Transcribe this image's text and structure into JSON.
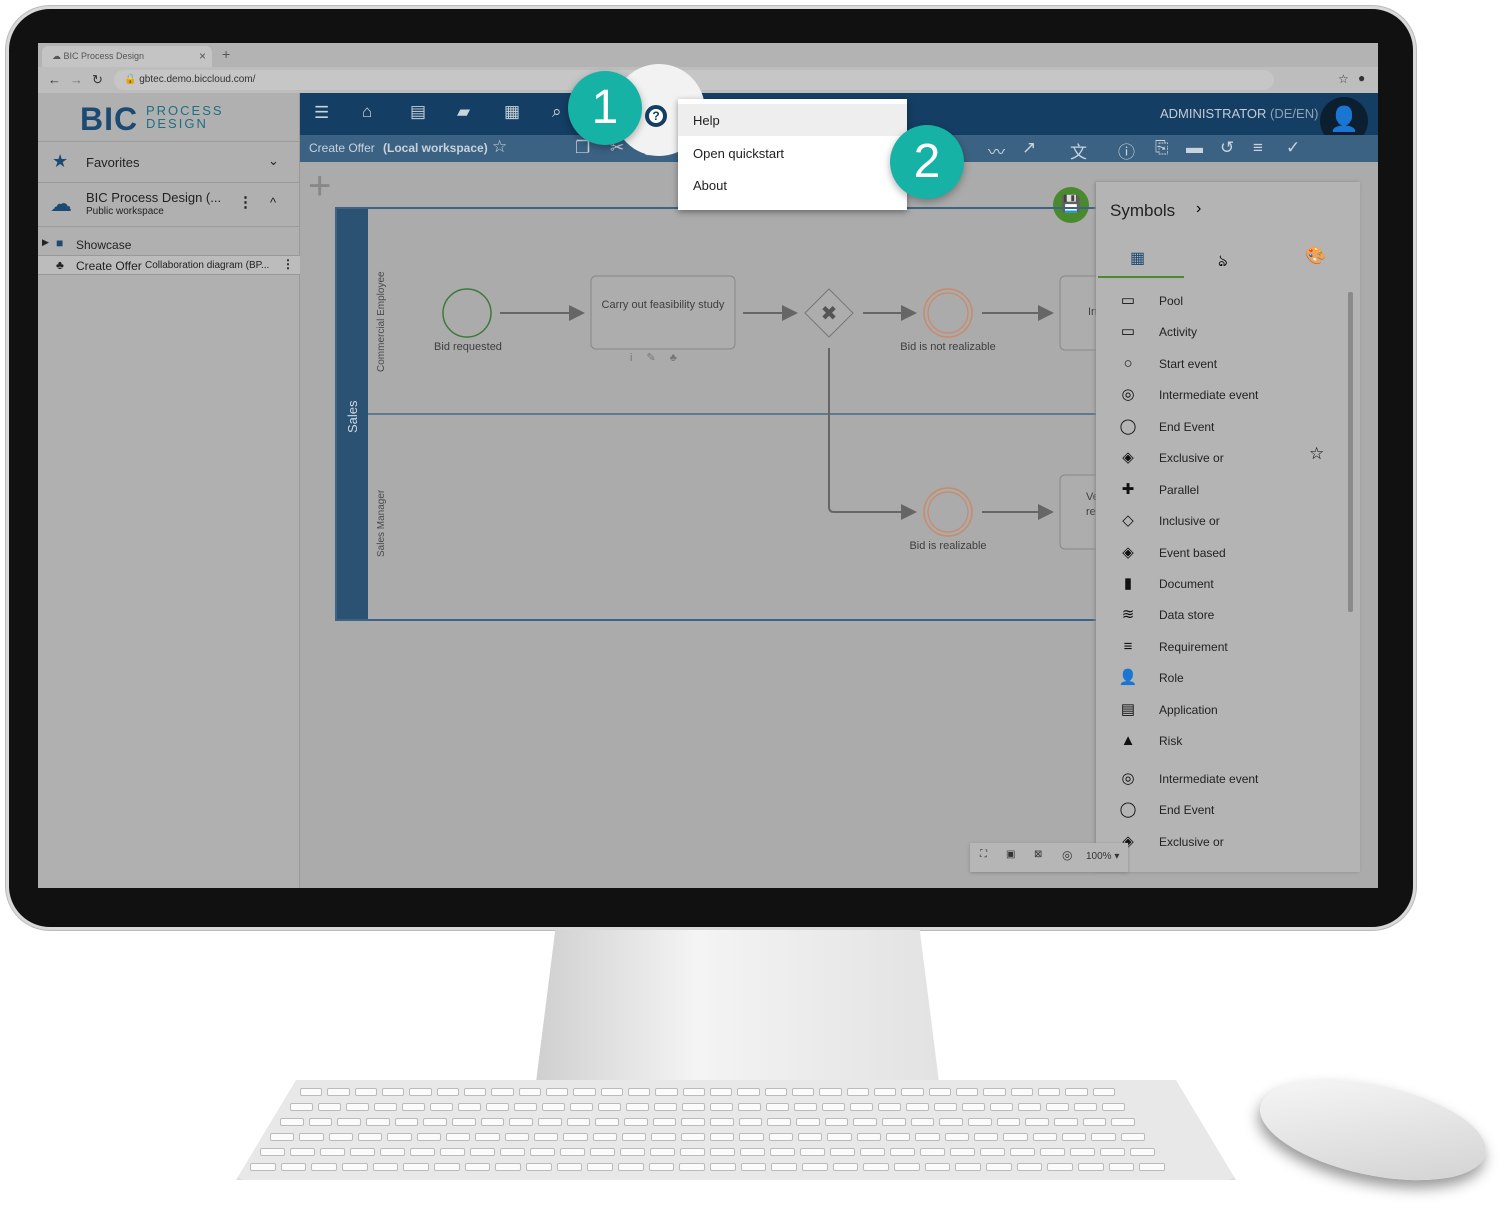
{
  "browser": {
    "tab_title": "BIC Process Design",
    "tab_close": "×",
    "new_tab": "+",
    "url": "gbtec.demo.biccloud.com/"
  },
  "logo": {
    "main": "BIC",
    "line1": "PROCESS",
    "line2": "DESIGN"
  },
  "sidebar": {
    "favorites": "Favorites",
    "workspace": {
      "title": "BIC Process Design (...",
      "subtitle": "Public workspace"
    },
    "tree": [
      {
        "label": "Showcase"
      },
      {
        "label": "Create Offer",
        "type": "Collaboration diagram (BP..."
      }
    ]
  },
  "header": {
    "user": "ADMINISTRATOR",
    "locale": "(DE/EN)"
  },
  "subheader": {
    "diagram": "Create Offer",
    "workspace": "(Local workspace)"
  },
  "help_menu": {
    "items": [
      "Help",
      "Open quickstart",
      "About"
    ]
  },
  "callouts": [
    "1",
    "2"
  ],
  "diagram": {
    "pool": "Sales",
    "lanes": [
      "Commercial Employee",
      "Sales Manager"
    ],
    "start_event": "Bid requested",
    "task": "Carry out feasibility study",
    "event_not": "Bid is not realizable",
    "event_yes": "Bid is realizable",
    "partial_task1": "In",
    "partial_task2a": "Ve",
    "partial_task2b": "re"
  },
  "symbols": {
    "title": "Symbols",
    "items": [
      "Pool",
      "Activity",
      "Start event",
      "Intermediate event",
      "End Event",
      "Exclusive or",
      "Parallel",
      "Inclusive or",
      "Event based",
      "Document",
      "Data store",
      "Requirement",
      "Role",
      "Application",
      "Risk",
      "Intermediate event",
      "End Event",
      "Exclusive or"
    ]
  },
  "zoom": {
    "level": "100%"
  },
  "colors": {
    "header": "#143e63",
    "callout": "#17b2a6",
    "save": "#4a8a2e",
    "start_event": "#3c7a3c",
    "intermediate_event": "#c98a6a"
  }
}
